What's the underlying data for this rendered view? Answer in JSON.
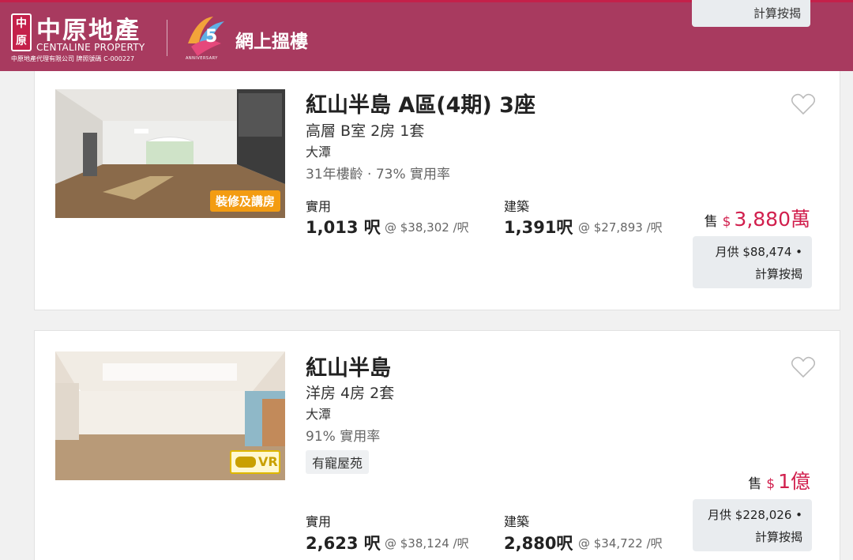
{
  "header": {
    "logo_seal": "中原",
    "logo_cn": "中原地產",
    "logo_en": "CENTALINE PROPERTY",
    "license": "中原地產代理有限公司 牌照號碼 C-000227",
    "anniversary_text": "ANNIVERSARY",
    "title": "網上搵樓",
    "calc_label": "計算按揭"
  },
  "listings": [
    {
      "title": "紅山半島 A區(4期) 3座",
      "subtitle": "高層 B室 2房 1套",
      "district": "大潭",
      "meta": "31年樓齡 · 73% 實用率",
      "badge": "裝修及講房",
      "saleable_label": "實用",
      "saleable_area": "1,013 呎",
      "saleable_unit": "@ $38,302 /呎",
      "gross_label": "建築",
      "gross_area": "1,391呎",
      "gross_unit": "@ $27,893 /呎",
      "sale_label": "售",
      "currency": "$",
      "price": "3,880萬",
      "monthly": "月供 $88,474 •",
      "calc_label": "計算按揭"
    },
    {
      "title": "紅山半島",
      "subtitle": "洋房 4房 2套",
      "district": "大潭",
      "meta": "91% 實用率",
      "tag": "有寵屋苑",
      "badge": "VR",
      "saleable_label": "實用",
      "saleable_area": "2,623 呎",
      "saleable_unit": "@ $38,124 /呎",
      "gross_label": "建築",
      "gross_area": "2,880呎",
      "gross_unit": "@ $34,722 /呎",
      "sale_label": "售",
      "currency": "$",
      "price": "1億",
      "monthly": "月供 $228,026 •",
      "calc_label": "計算按揭"
    }
  ],
  "colors": {
    "header_bg": "#a83a5f",
    "price": "#d11f4d",
    "badge_reno": "#f39c12"
  }
}
